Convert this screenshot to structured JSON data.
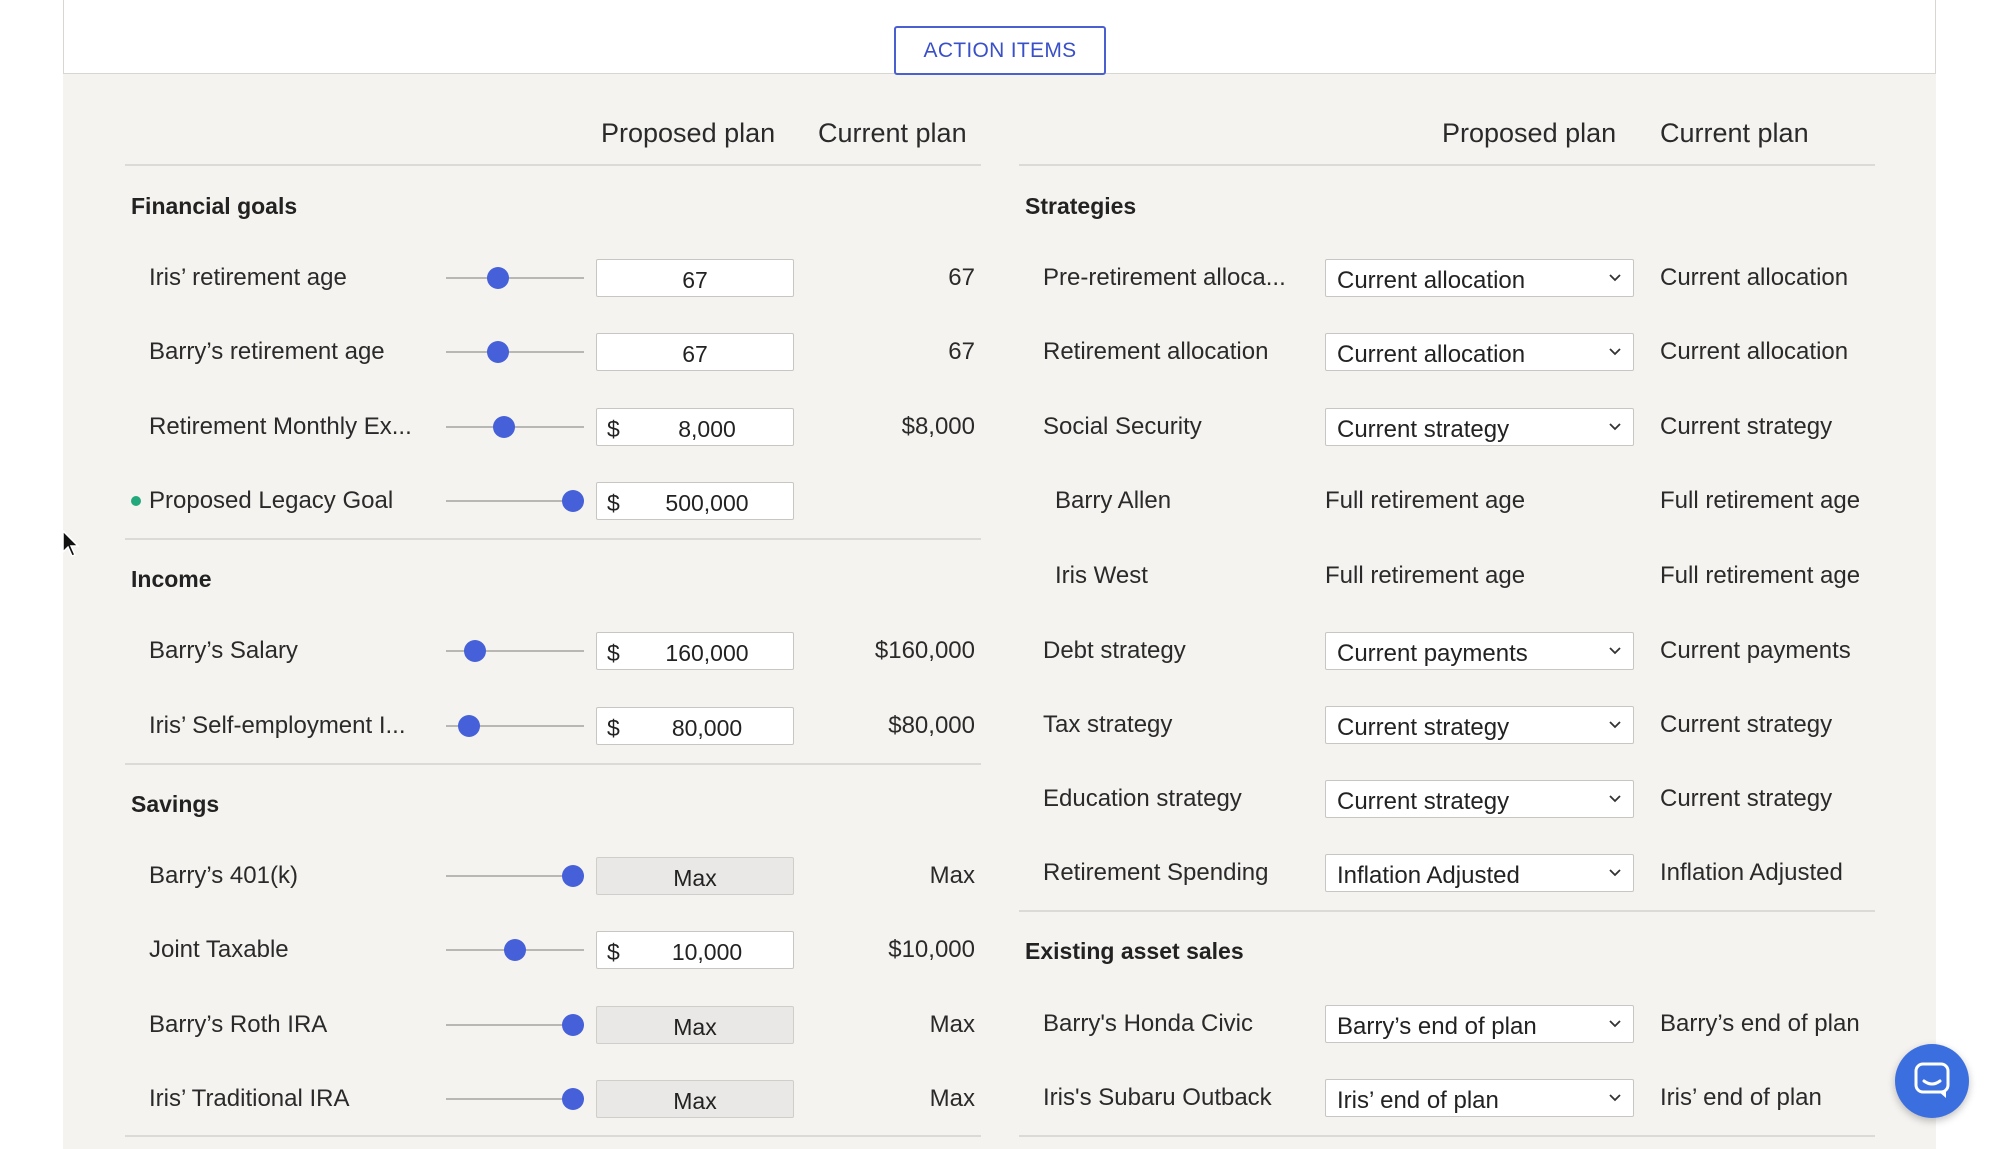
{
  "top": {
    "action_items": "ACTION ITEMS"
  },
  "headers": {
    "proposed": "Proposed plan",
    "current": "Current plan"
  },
  "left": {
    "financial_goals": {
      "title": "Financial goals",
      "rows": [
        {
          "label": "Iris’ retirement age",
          "slider": 0.38,
          "prefix": "",
          "value": "67",
          "current": "67"
        },
        {
          "label": "Barry’s retirement age",
          "slider": 0.38,
          "prefix": "",
          "value": "67",
          "current": "67"
        },
        {
          "label": "Retirement Monthly Ex...",
          "slider": 0.42,
          "prefix": "$",
          "value": "8,000",
          "current": "$8,000"
        },
        {
          "label": "Proposed Legacy Goal",
          "slider": 0.92,
          "prefix": "$",
          "value": "500,000",
          "current": ""
        }
      ]
    },
    "income": {
      "title": "Income",
      "rows": [
        {
          "label": "Barry’s Salary",
          "slider": 0.21,
          "prefix": "$",
          "value": "160,000",
          "current": "$160,000"
        },
        {
          "label": "Iris’ Self-employment I...",
          "slider": 0.17,
          "prefix": "$",
          "value": "80,000",
          "current": "$80,000"
        }
      ]
    },
    "savings": {
      "title": "Savings",
      "rows": [
        {
          "label": "Barry’s 401(k)",
          "slider": 0.92,
          "prefix": "",
          "value": "Max",
          "current": "Max"
        },
        {
          "label": "Joint Taxable",
          "slider": 0.5,
          "prefix": "$",
          "value": "10,000",
          "current": "$10,000"
        },
        {
          "label": "Barry’s Roth IRA",
          "slider": 0.92,
          "prefix": "",
          "value": "Max",
          "current": "Max"
        },
        {
          "label": "Iris’ Traditional IRA",
          "slider": 0.92,
          "prefix": "",
          "value": "Max",
          "current": "Max"
        }
      ]
    }
  },
  "right": {
    "strategies": {
      "title": "Strategies",
      "rows": [
        {
          "label": "Pre-retirement alloca...",
          "proposed": "Current allocation",
          "current": "Current allocation"
        },
        {
          "label": "Retirement allocation",
          "proposed": "Current allocation",
          "current": "Current allocation"
        },
        {
          "label": "Social Security",
          "proposed": "Current strategy",
          "current": "Current strategy"
        },
        {
          "label": "Barry Allen",
          "proposed": "Full retirement age",
          "current": "Full retirement age"
        },
        {
          "label": "Iris West",
          "proposed": "Full retirement age",
          "current": "Full retirement age"
        },
        {
          "label": "Debt strategy",
          "proposed": "Current payments",
          "current": "Current payments"
        },
        {
          "label": "Tax strategy",
          "proposed": "Current strategy",
          "current": "Current strategy"
        },
        {
          "label": "Education strategy",
          "proposed": "Current strategy",
          "current": "Current strategy"
        },
        {
          "label": "Retirement Spending",
          "proposed": "Inflation Adjusted",
          "current": "Inflation Adjusted"
        }
      ]
    },
    "asset_sales": {
      "title": "Existing asset sales",
      "rows": [
        {
          "label": "Barry's Honda Civic",
          "proposed": "Barry’s end of plan",
          "current": "Barry’s end of plan"
        },
        {
          "label": "Iris's Subaru Outback",
          "proposed": "Iris’ end of plan",
          "current": "Iris’ end of plan"
        }
      ]
    }
  },
  "colors": {
    "accent": "#4560d8",
    "background": "#f5f3f0",
    "dot": "#23a87b",
    "chat": "#3b6fe0"
  },
  "icons": [
    "chevron-down-icon",
    "cursor-icon",
    "chat-icon"
  ]
}
